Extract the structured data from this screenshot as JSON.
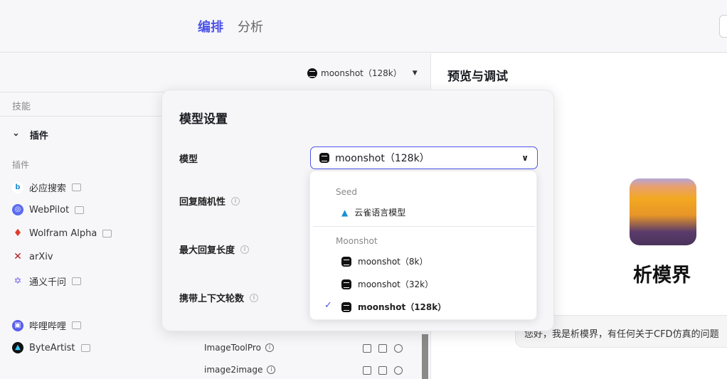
{
  "header": {
    "tabs": [
      {
        "label": "编排"
      },
      {
        "label": "分析"
      }
    ]
  },
  "model_selector": {
    "label": "moonshot（128k）"
  },
  "left": {
    "section_label": "技能",
    "plugins_header": "插件",
    "plugins_sub": "插件",
    "plugins": [
      {
        "name": "必应搜索",
        "icon": "bing-icon",
        "color": "#1a8fd8"
      },
      {
        "name": "WebPilot",
        "icon": "webpilot-icon",
        "color": "#5b6cf0"
      },
      {
        "name": "Wolfram Alpha",
        "icon": "wolfram-icon",
        "color": "#e03c2c"
      },
      {
        "name": "arXiv",
        "icon": "arxiv-icon",
        "color": "#b31b1b"
      },
      {
        "name": "通义千问",
        "icon": "tongyi-icon",
        "color": "#6a5cf0"
      },
      {
        "name": "哔哩哔哩",
        "icon": "bilibili-icon",
        "color": "#5b5cf0"
      },
      {
        "name": "ByteArtist",
        "icon": "byteartist-icon",
        "color": "#111"
      }
    ],
    "tools": [
      {
        "name": "ImageToolPro"
      },
      {
        "name": "image2image"
      }
    ]
  },
  "model_settings": {
    "title": "模型设置",
    "model_label": "模型",
    "selected": "moonshot（128k）",
    "randomness_label": "回复随机性",
    "max_length_label": "最大回复长度",
    "context_rounds_label": "携带上下文轮数",
    "groups": [
      {
        "name": "Seed",
        "options": [
          {
            "label": "云雀语言模型"
          }
        ]
      },
      {
        "name": "Moonshot",
        "options": [
          {
            "label": "moonshot（8k）"
          },
          {
            "label": "moonshot（32k）"
          },
          {
            "label": "moonshot（128k）",
            "selected": true
          }
        ]
      }
    ]
  },
  "preview": {
    "title": "预览与调试",
    "bot_name": "析模界",
    "greeting": "您好，我是析模界，有任何关于CFD仿真的问题"
  },
  "colors": {
    "accent": "#4d53e8"
  }
}
